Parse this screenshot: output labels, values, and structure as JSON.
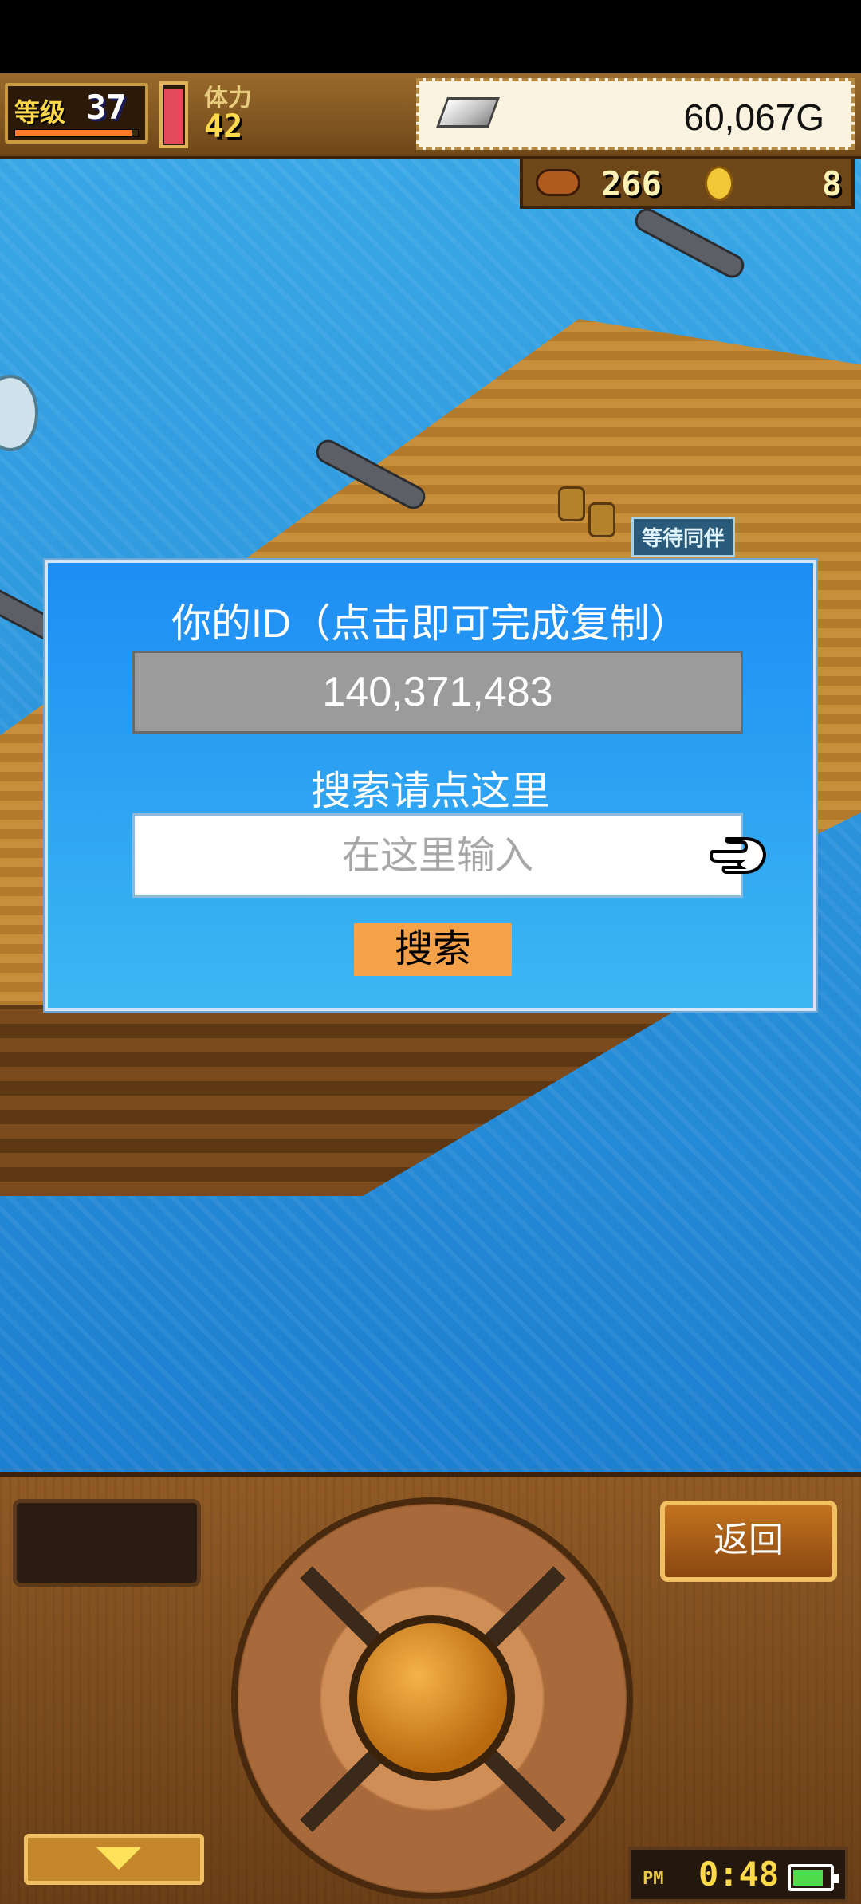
{
  "hud": {
    "level_label": "等级",
    "level_value": "37",
    "level_progress": 0.95,
    "stamina_label": "体力",
    "stamina_value": "42",
    "stamina_fill": 0.95,
    "gold_value": "60,067G",
    "resource_food": "266",
    "resource_coin": "8"
  },
  "scene": {
    "waiting_sign": "等待同伴"
  },
  "dialog": {
    "title": "你的ID（点击即可完成复制）",
    "player_id": "140,371,483",
    "search_hint": "搜索请点这里",
    "search_placeholder": "在这里输入",
    "search_button": "搜索"
  },
  "panel": {
    "back_button": "返回",
    "clock_ampm": "PM",
    "clock_time": "0:48",
    "battery_level": 0.85
  },
  "colors": {
    "dialog_top": "#1e8df4",
    "dialog_bottom": "#3cb7f2",
    "search_button": "#f4a14a",
    "id_box": "#9b9b9b"
  }
}
